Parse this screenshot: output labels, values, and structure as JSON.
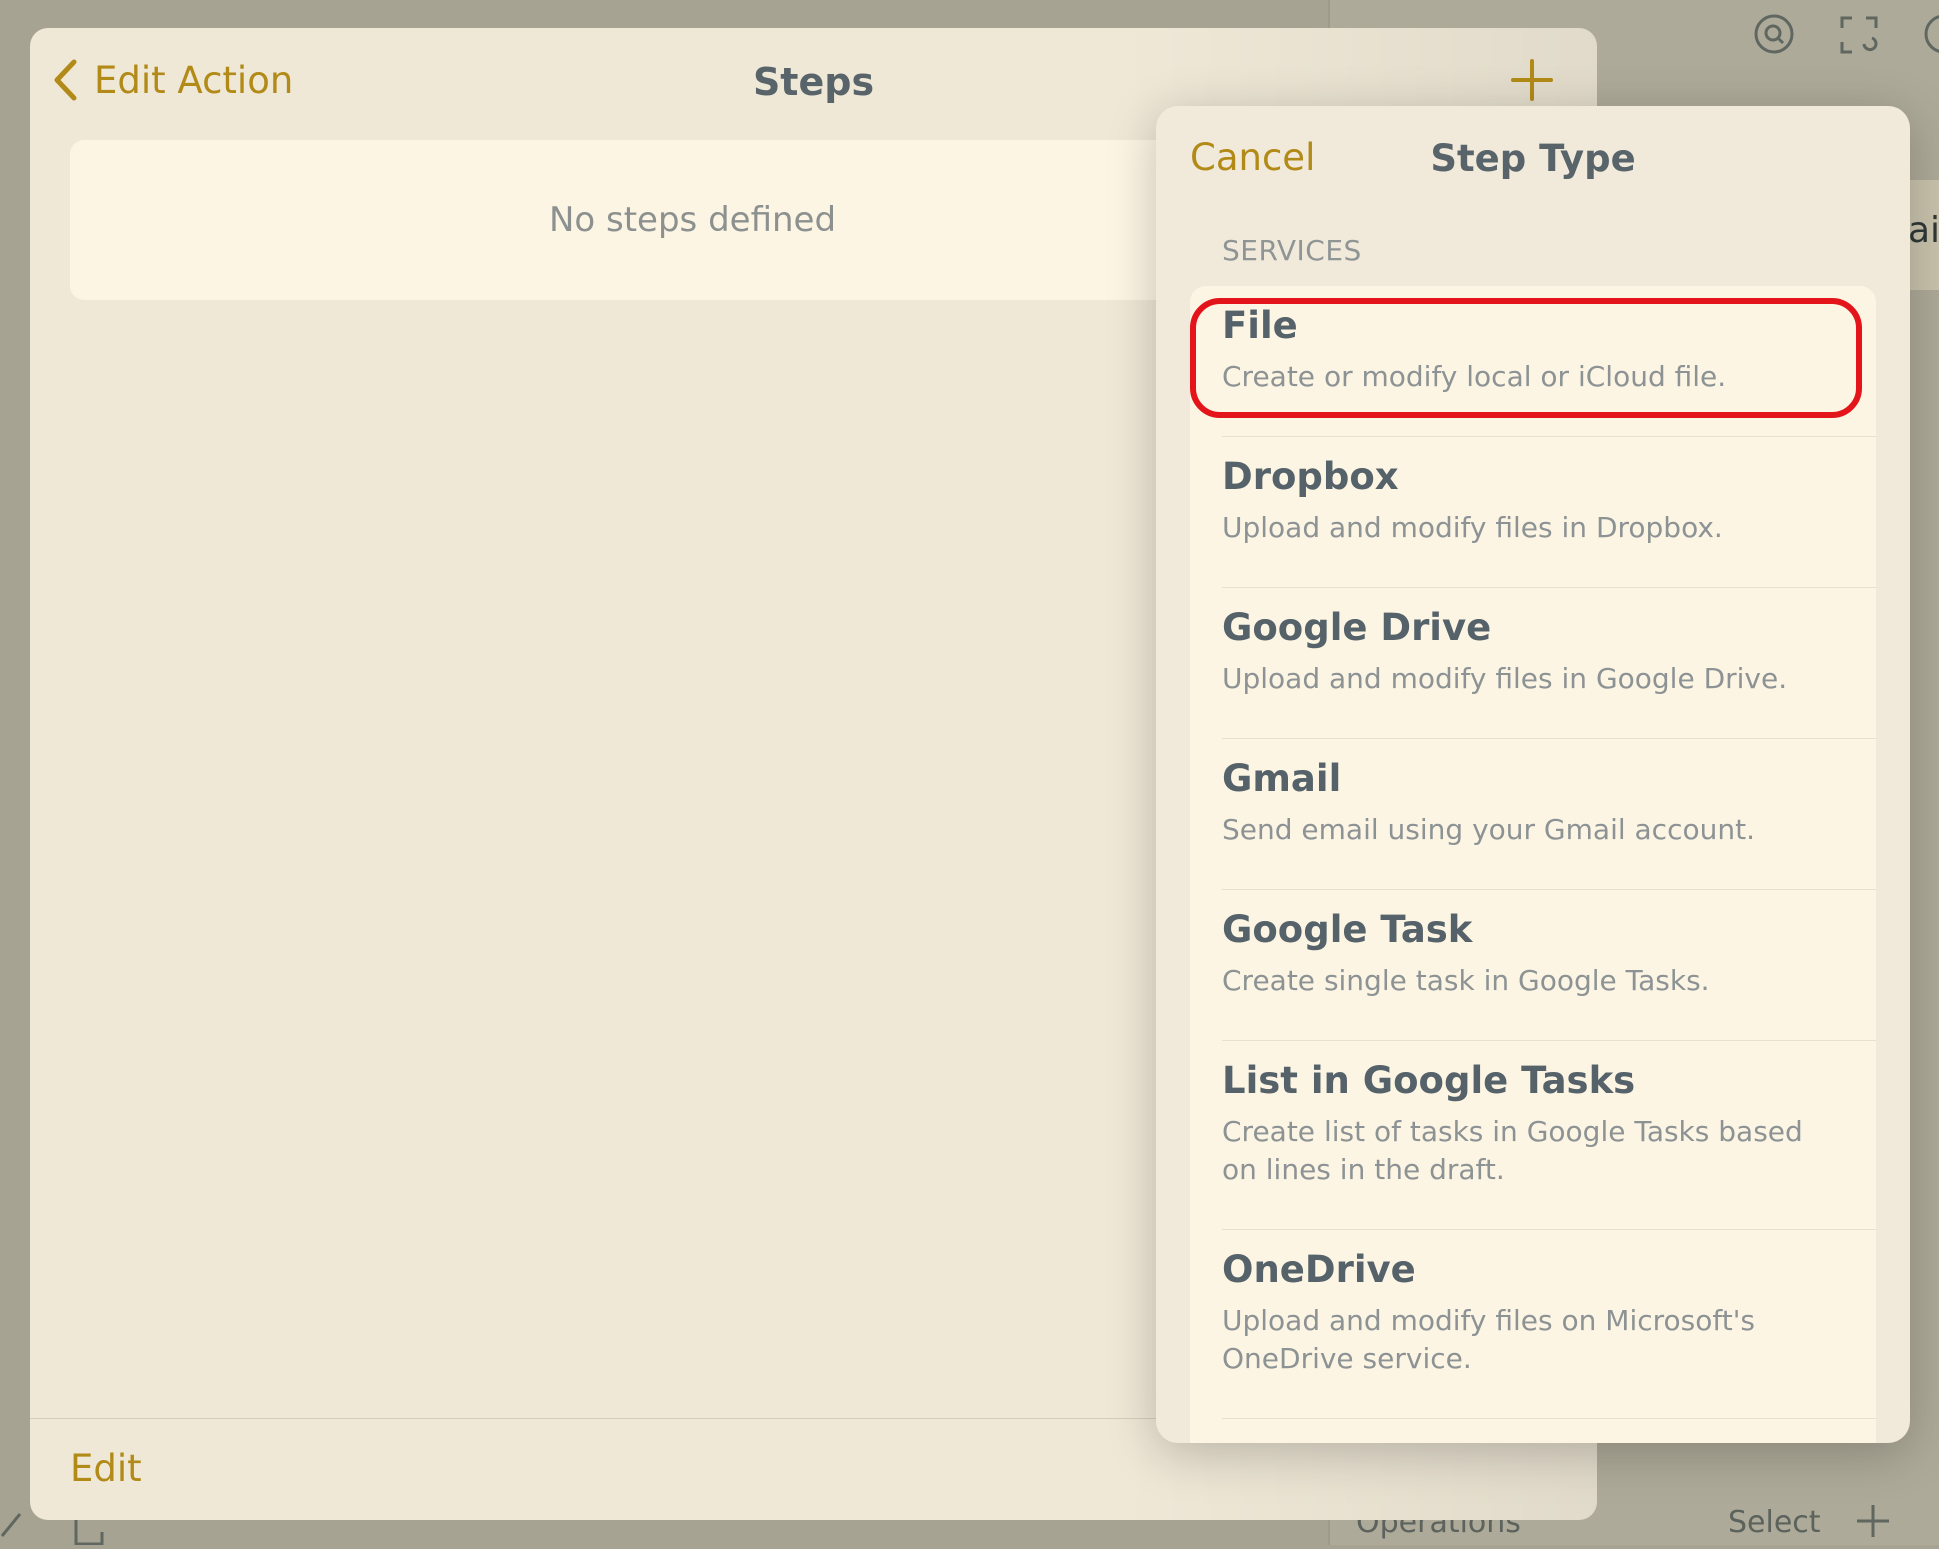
{
  "background": {
    "bottom_left_label": "Operations",
    "bottom_right_label": "Select"
  },
  "sheet": {
    "back_label": "Edit Action",
    "title": "Steps",
    "empty_message": "No steps defined",
    "edit_label": "Edit"
  },
  "popover": {
    "cancel_label": "Cancel",
    "title": "Step Type",
    "section_header": "SERVICES",
    "items": [
      {
        "title": "File",
        "description": "Create or modify local or iCloud file."
      },
      {
        "title": "Dropbox",
        "description": "Upload and modify files in Dropbox."
      },
      {
        "title": "Google Drive",
        "description": "Upload and modify files in Google Drive."
      },
      {
        "title": "Gmail",
        "description": "Send email using your Gmail account."
      },
      {
        "title": "Google Task",
        "description": "Create single task in Google Tasks."
      },
      {
        "title": "List in Google Tasks",
        "description": "Create list of tasks in Google Tasks based on lines in the draft."
      },
      {
        "title": "OneDrive",
        "description": "Upload and modify files on Microsoft's OneDrive service."
      }
    ]
  },
  "colors": {
    "accent": "#b28a17",
    "title_text": "#58646a",
    "highlight": "#e3141a"
  }
}
